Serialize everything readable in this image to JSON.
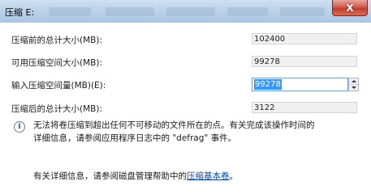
{
  "window": {
    "title": "压缩 E:",
    "close_label": "X"
  },
  "fields": [
    {
      "label": "压缩前的总计大小(MB):",
      "value": "102400"
    },
    {
      "label": "可用压缩空间大小(MB):",
      "value": "99278"
    },
    {
      "label": "输入压缩空间量(MB)(E):",
      "value": "99278"
    },
    {
      "label": "压缩后的总计大小(MB):",
      "value": "3122"
    }
  ],
  "info": {
    "icon": "info-icon",
    "line1": "无法将卷压缩到超出任何不可移动的文件所在的点。有关完成该操作时间的",
    "line2": "详细信息，请参阅应用程序日志中的 \"defrag\" 事件。"
  },
  "details": {
    "prefix": "有关详细信息，请参阅磁盘管理帮助中的",
    "link": "压缩基本卷",
    "suffix": "。"
  }
}
